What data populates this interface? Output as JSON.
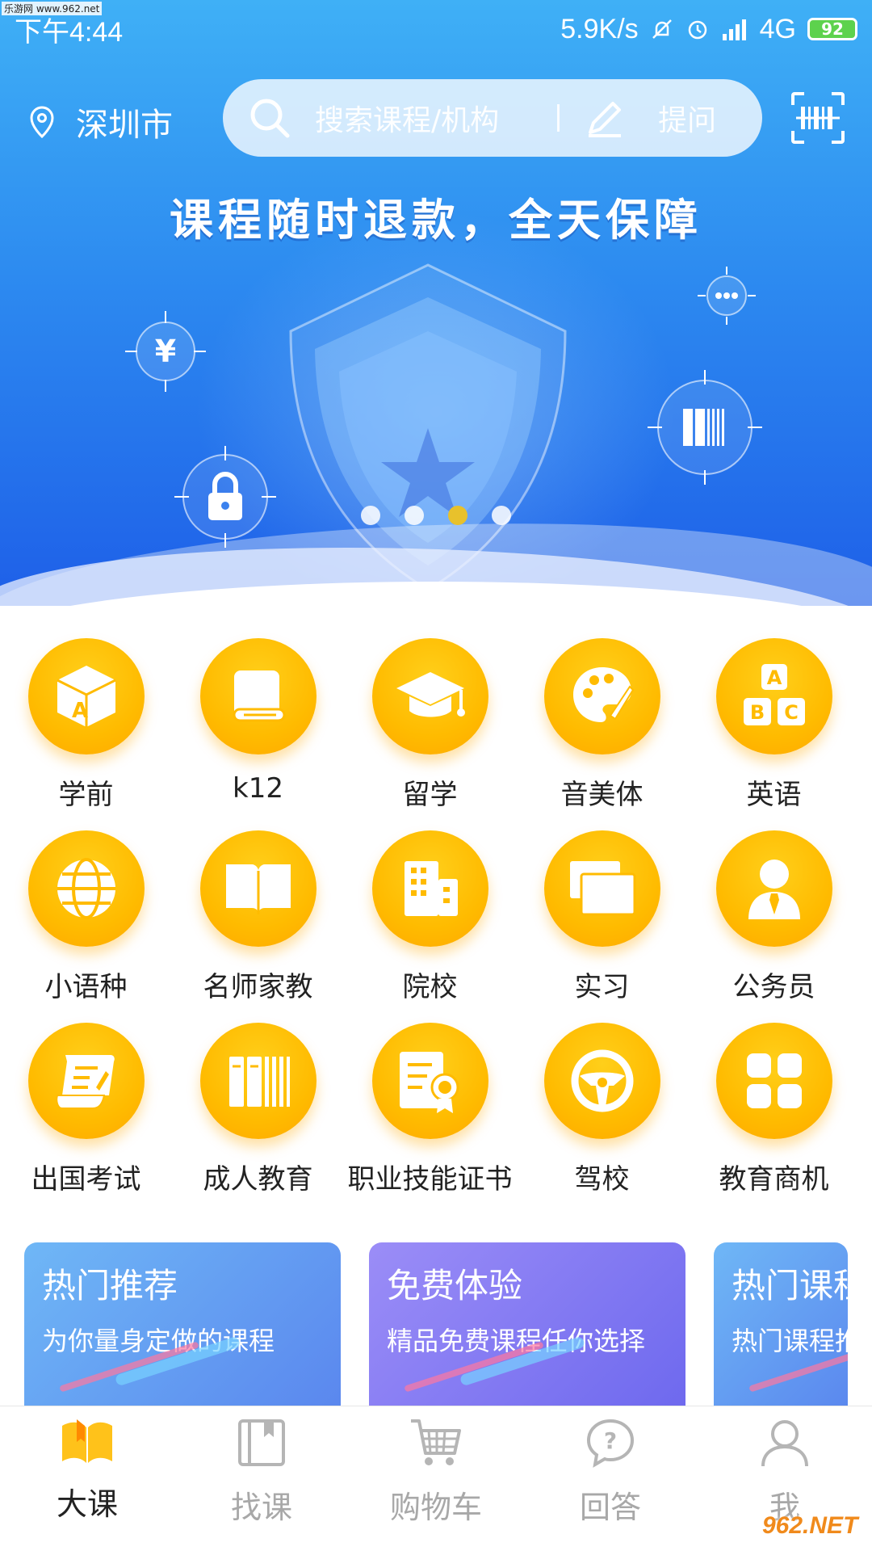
{
  "watermark_top": "乐游网 www.962.net",
  "watermark_bottom": "962.NET",
  "status_bar": {
    "time": "下午4:44",
    "network_speed": "5.9K/s",
    "network_type": "4G",
    "battery": "92"
  },
  "header": {
    "city": "深圳市",
    "search_placeholder": "搜索课程/机构",
    "ask_label": "提问"
  },
  "banner": {
    "title": "课程随时退款，全天保障",
    "dots": 4,
    "active_dot": 3
  },
  "categories": [
    {
      "label": "学前",
      "icon": "cube-a-icon"
    },
    {
      "label": "k12",
      "icon": "book-icon"
    },
    {
      "label": "留学",
      "icon": "graduation-cap-icon"
    },
    {
      "label": "音美体",
      "icon": "palette-icon"
    },
    {
      "label": "英语",
      "icon": "abc-blocks-icon"
    },
    {
      "label": "小语种",
      "icon": "globe-icon"
    },
    {
      "label": "名师家教",
      "icon": "open-book-icon"
    },
    {
      "label": "院校",
      "icon": "building-icon"
    },
    {
      "label": "实习",
      "icon": "windows-icon"
    },
    {
      "label": "公务员",
      "icon": "person-tie-icon"
    },
    {
      "label": "出国考试",
      "icon": "scroll-icon"
    },
    {
      "label": "成人教育",
      "icon": "bookshelf-icon"
    },
    {
      "label": "职业技能证书",
      "icon": "certificate-icon"
    },
    {
      "label": "驾校",
      "icon": "steering-wheel-icon"
    },
    {
      "label": "教育商机",
      "icon": "grid-icon"
    }
  ],
  "promo_cards": [
    {
      "title": "热门推荐",
      "subtitle": "为你量身定做的课程"
    },
    {
      "title": "免费体验",
      "subtitle": "精品免费课程任你选择"
    },
    {
      "title": "热门课程",
      "subtitle": "热门课程推荐"
    }
  ],
  "bottom_nav": [
    {
      "label": "大课",
      "icon": "open-book-icon",
      "active": true
    },
    {
      "label": "找课",
      "icon": "bookmark-book-icon",
      "active": false
    },
    {
      "label": "购物车",
      "icon": "cart-icon",
      "active": false
    },
    {
      "label": "回答",
      "icon": "question-bubble-icon",
      "active": false
    },
    {
      "label": "我",
      "icon": "person-icon",
      "active": false
    }
  ],
  "colors": {
    "accent": "#ffbb00",
    "hero_top": "#3fb0f6",
    "hero_bottom": "#1e5fe8",
    "active_dot": "#e8c12c"
  }
}
